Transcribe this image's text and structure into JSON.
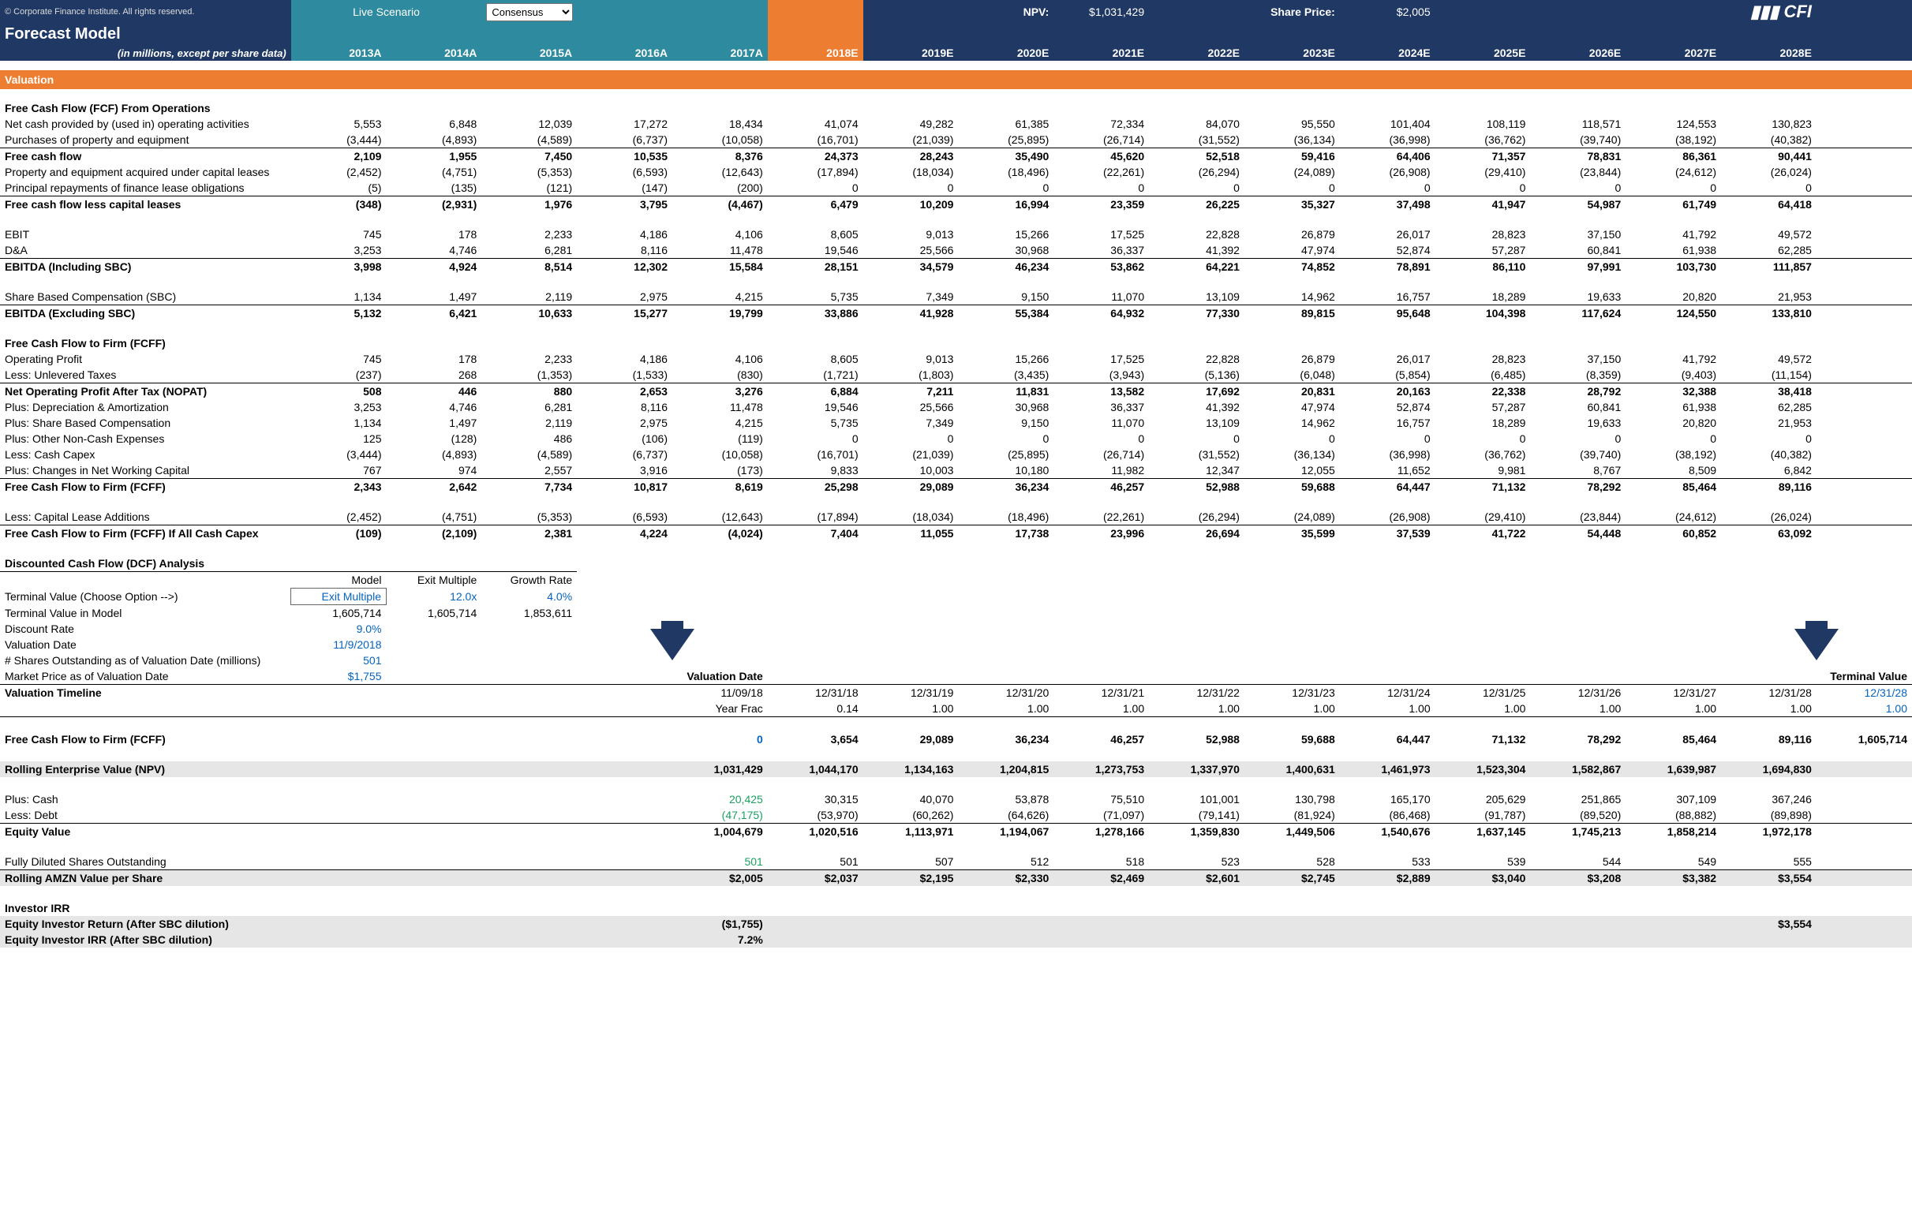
{
  "header": {
    "copyright": "© Corporate Finance Institute. All rights reserved.",
    "title": "Forecast Model",
    "subtitle": "(in millions, except per share data)",
    "live_scenario_label": "Live Scenario",
    "scenario_value": "Consensus",
    "npv_label": "NPV:",
    "npv_value": "$1,031,429",
    "share_price_label": "Share Price:",
    "share_price_value": "$2,005",
    "logo": "CFI",
    "years": [
      "2013A",
      "2014A",
      "2015A",
      "2016A",
      "2017A",
      "2018E",
      "2019E",
      "2020E",
      "2021E",
      "2022E",
      "2023E",
      "2024E",
      "2025E",
      "2026E",
      "2027E",
      "2028E"
    ]
  },
  "section_valuation": "Valuation",
  "rows": {
    "fcf_ops_title": "Free Cash Flow (FCF) From Operations",
    "net_cash": {
      "l": "Net cash provided by (used in) operating activities",
      "v": [
        "5,553",
        "6,848",
        "12,039",
        "17,272",
        "18,434",
        "41,074",
        "49,282",
        "61,385",
        "72,334",
        "84,070",
        "95,550",
        "101,404",
        "108,119",
        "118,571",
        "124,553",
        "130,823"
      ]
    },
    "purchases": {
      "l": "Purchases of property and equipment",
      "v": [
        "(3,444)",
        "(4,893)",
        "(4,589)",
        "(6,737)",
        "(10,058)",
        "(16,701)",
        "(21,039)",
        "(25,895)",
        "(26,714)",
        "(31,552)",
        "(36,134)",
        "(36,998)",
        "(36,762)",
        "(39,740)",
        "(38,192)",
        "(40,382)"
      ]
    },
    "fcf": {
      "l": "Free cash flow",
      "v": [
        "2,109",
        "1,955",
        "7,450",
        "10,535",
        "8,376",
        "24,373",
        "28,243",
        "35,490",
        "45,620",
        "52,518",
        "59,416",
        "64,406",
        "71,357",
        "78,831",
        "86,361",
        "90,441"
      ]
    },
    "cap_lease": {
      "l": "Property and equipment acquired under capital leases",
      "v": [
        "(2,452)",
        "(4,751)",
        "(5,353)",
        "(6,593)",
        "(12,643)",
        "(17,894)",
        "(18,034)",
        "(18,496)",
        "(22,261)",
        "(26,294)",
        "(24,089)",
        "(26,908)",
        "(29,410)",
        "(23,844)",
        "(24,612)",
        "(26,024)"
      ]
    },
    "fin_lease": {
      "l": "Principal repayments of finance lease obligations",
      "v": [
        "(5)",
        "(135)",
        "(121)",
        "(147)",
        "(200)",
        "0",
        "0",
        "0",
        "0",
        "0",
        "0",
        "0",
        "0",
        "0",
        "0",
        "0"
      ]
    },
    "fcf_less": {
      "l": "Free cash flow less capital leases",
      "v": [
        "(348)",
        "(2,931)",
        "1,976",
        "3,795",
        "(4,467)",
        "6,479",
        "10,209",
        "16,994",
        "23,359",
        "26,225",
        "35,327",
        "37,498",
        "41,947",
        "54,987",
        "61,749",
        "64,418"
      ]
    },
    "ebit": {
      "l": "EBIT",
      "v": [
        "745",
        "178",
        "2,233",
        "4,186",
        "4,106",
        "8,605",
        "9,013",
        "15,266",
        "17,525",
        "22,828",
        "26,879",
        "26,017",
        "28,823",
        "37,150",
        "41,792",
        "49,572"
      ]
    },
    "da": {
      "l": "D&A",
      "v": [
        "3,253",
        "4,746",
        "6,281",
        "8,116",
        "11,478",
        "19,546",
        "25,566",
        "30,968",
        "36,337",
        "41,392",
        "47,974",
        "52,874",
        "57,287",
        "60,841",
        "61,938",
        "62,285"
      ]
    },
    "ebitda_inc": {
      "l": "EBITDA (Including SBC)",
      "v": [
        "3,998",
        "4,924",
        "8,514",
        "12,302",
        "15,584",
        "28,151",
        "34,579",
        "46,234",
        "53,862",
        "64,221",
        "74,852",
        "78,891",
        "86,110",
        "97,991",
        "103,730",
        "111,857"
      ]
    },
    "sbc": {
      "l": "Share Based Compensation (SBC)",
      "v": [
        "1,134",
        "1,497",
        "2,119",
        "2,975",
        "4,215",
        "5,735",
        "7,349",
        "9,150",
        "11,070",
        "13,109",
        "14,962",
        "16,757",
        "18,289",
        "19,633",
        "20,820",
        "21,953"
      ]
    },
    "ebitda_ex": {
      "l": "EBITDA (Excluding SBC)",
      "v": [
        "5,132",
        "6,421",
        "10,633",
        "15,277",
        "19,799",
        "33,886",
        "41,928",
        "55,384",
        "64,932",
        "77,330",
        "89,815",
        "95,648",
        "104,398",
        "117,624",
        "124,550",
        "133,810"
      ]
    },
    "fcff_title": "Free Cash Flow to Firm (FCFF)",
    "op_profit": {
      "l": "Operating Profit",
      "v": [
        "745",
        "178",
        "2,233",
        "4,186",
        "4,106",
        "8,605",
        "9,013",
        "15,266",
        "17,525",
        "22,828",
        "26,879",
        "26,017",
        "28,823",
        "37,150",
        "41,792",
        "49,572"
      ]
    },
    "unlev_tax": {
      "l": "  Less: Unlevered Taxes",
      "v": [
        "(237)",
        "268",
        "(1,353)",
        "(1,533)",
        "(830)",
        "(1,721)",
        "(1,803)",
        "(3,435)",
        "(3,943)",
        "(5,136)",
        "(6,048)",
        "(5,854)",
        "(6,485)",
        "(8,359)",
        "(9,403)",
        "(11,154)"
      ]
    },
    "nopat": {
      "l": "Net Operating Profit After Tax (NOPAT)",
      "v": [
        "508",
        "446",
        "880",
        "2,653",
        "3,276",
        "6,884",
        "7,211",
        "11,831",
        "13,582",
        "17,692",
        "20,831",
        "20,163",
        "22,338",
        "28,792",
        "32,388",
        "38,418"
      ]
    },
    "plus_da": {
      "l": "  Plus: Depreciation & Amortization",
      "v": [
        "3,253",
        "4,746",
        "6,281",
        "8,116",
        "11,478",
        "19,546",
        "25,566",
        "30,968",
        "36,337",
        "41,392",
        "47,974",
        "52,874",
        "57,287",
        "60,841",
        "61,938",
        "62,285"
      ]
    },
    "plus_sbc": {
      "l": "  Plus: Share Based Compensation",
      "v": [
        "1,134",
        "1,497",
        "2,119",
        "2,975",
        "4,215",
        "5,735",
        "7,349",
        "9,150",
        "11,070",
        "13,109",
        "14,962",
        "16,757",
        "18,289",
        "19,633",
        "20,820",
        "21,953"
      ]
    },
    "plus_other": {
      "l": "  Plus: Other Non-Cash Expenses",
      "v": [
        "125",
        "(128)",
        "486",
        "(106)",
        "(119)",
        "0",
        "0",
        "0",
        "0",
        "0",
        "0",
        "0",
        "0",
        "0",
        "0",
        "0"
      ]
    },
    "less_capex": {
      "l": "  Less: Cash Capex",
      "v": [
        "(3,444)",
        "(4,893)",
        "(4,589)",
        "(6,737)",
        "(10,058)",
        "(16,701)",
        "(21,039)",
        "(25,895)",
        "(26,714)",
        "(31,552)",
        "(36,134)",
        "(36,998)",
        "(36,762)",
        "(39,740)",
        "(38,192)",
        "(40,382)"
      ]
    },
    "plus_nwc": {
      "l": "  Plus: Changes in Net Working Capital",
      "v": [
        "767",
        "974",
        "2,557",
        "3,916",
        "(173)",
        "9,833",
        "10,003",
        "10,180",
        "11,982",
        "12,347",
        "12,055",
        "11,652",
        "9,981",
        "8,767",
        "8,509",
        "6,842"
      ]
    },
    "fcff": {
      "l": "Free Cash Flow to Firm (FCFF)",
      "v": [
        "2,343",
        "2,642",
        "7,734",
        "10,817",
        "8,619",
        "25,298",
        "29,089",
        "36,234",
        "46,257",
        "52,988",
        "59,688",
        "64,447",
        "71,132",
        "78,292",
        "85,464",
        "89,116"
      ]
    },
    "less_cla": {
      "l": "  Less: Capital Lease Additions",
      "v": [
        "(2,452)",
        "(4,751)",
        "(5,353)",
        "(6,593)",
        "(12,643)",
        "(17,894)",
        "(18,034)",
        "(18,496)",
        "(22,261)",
        "(26,294)",
        "(24,089)",
        "(26,908)",
        "(29,410)",
        "(23,844)",
        "(24,612)",
        "(26,024)"
      ]
    },
    "fcff_all": {
      "l": "Free Cash Flow to Firm (FCFF) If All Cash Capex",
      "v": [
        "(109)",
        "(2,109)",
        "2,381",
        "4,224",
        "(4,024)",
        "7,404",
        "11,055",
        "17,738",
        "23,996",
        "26,694",
        "35,599",
        "37,539",
        "41,722",
        "54,448",
        "60,852",
        "63,092"
      ]
    }
  },
  "dcf": {
    "title": "Discounted Cash Flow (DCF) Analysis",
    "cols": [
      "Model",
      "Exit Multiple",
      "Growth Rate"
    ],
    "tv_choose": {
      "l": "Terminal Value (Choose Option -->)",
      "v": [
        "Exit Multiple",
        "12.0x",
        "4.0%"
      ]
    },
    "tv_model": {
      "l": "Terminal Value in Model",
      "v": [
        "1,605,714",
        "1,605,714",
        "1,853,611"
      ]
    },
    "disc_rate": {
      "l": "Discount Rate",
      "v": "9.0%"
    },
    "val_date": {
      "l": "Valuation Date",
      "v": "11/9/2018"
    },
    "shares_out": {
      "l": "# Shares Outstanding as of Valuation Date (millions)",
      "v": "501"
    },
    "mkt_price": {
      "l": "Market Price as of Valuation Date",
      "v": "$1,755"
    }
  },
  "timeline": {
    "val_date_label": "Valuation Date",
    "term_val_label": "Terminal Value",
    "title": "Valuation Timeline",
    "dates": [
      "11/09/18",
      "12/31/18",
      "12/31/19",
      "12/31/20",
      "12/31/21",
      "12/31/22",
      "12/31/23",
      "12/31/24",
      "12/31/25",
      "12/31/26",
      "12/31/27",
      "12/31/28",
      "12/31/28"
    ],
    "yf_label": "Year Frac",
    "year_frac": [
      "0.14",
      "1.00",
      "1.00",
      "1.00",
      "1.00",
      "1.00",
      "1.00",
      "1.00",
      "1.00",
      "1.00",
      "1.00",
      "1.00",
      "1.00"
    ],
    "fcff_label": "Free Cash Flow to Firm (FCFF)",
    "fcff": [
      "0",
      "3,654",
      "29,089",
      "36,234",
      "46,257",
      "52,988",
      "59,688",
      "64,447",
      "71,132",
      "78,292",
      "85,464",
      "89,116",
      "1,605,714"
    ],
    "npv_label": "Rolling Enterprise Value (NPV)",
    "npv": [
      "1,031,429",
      "1,044,170",
      "1,134,163",
      "1,204,815",
      "1,273,753",
      "1,337,970",
      "1,400,631",
      "1,461,973",
      "1,523,304",
      "1,582,867",
      "1,639,987",
      "1,694,830"
    ],
    "plus_cash": {
      "l": "Plus: Cash",
      "v": [
        "20,425",
        "30,315",
        "40,070",
        "53,878",
        "75,510",
        "101,001",
        "130,798",
        "165,170",
        "205,629",
        "251,865",
        "307,109",
        "367,246"
      ]
    },
    "less_debt": {
      "l": "Less: Debt",
      "v": [
        "(47,175)",
        "(53,970)",
        "(60,262)",
        "(64,626)",
        "(71,097)",
        "(79,141)",
        "(81,924)",
        "(86,468)",
        "(91,787)",
        "(89,520)",
        "(88,882)",
        "(89,898)"
      ]
    },
    "equity": {
      "l": "Equity Value",
      "v": [
        "1,004,679",
        "1,020,516",
        "1,113,971",
        "1,194,067",
        "1,278,166",
        "1,359,830",
        "1,449,506",
        "1,540,676",
        "1,637,145",
        "1,745,213",
        "1,858,214",
        "1,972,178"
      ]
    },
    "fd_shares": {
      "l": "Fully Diluted Shares Outstanding",
      "v": [
        "501",
        "501",
        "507",
        "512",
        "518",
        "523",
        "528",
        "533",
        "539",
        "544",
        "549",
        "555"
      ]
    },
    "rolling": {
      "l": "Rolling AMZN Value per Share",
      "v": [
        "$2,005",
        "$2,037",
        "$2,195",
        "$2,330",
        "$2,469",
        "$2,601",
        "$2,745",
        "$2,889",
        "$3,040",
        "$3,208",
        "$3,382",
        "$3,554"
      ]
    }
  },
  "irr": {
    "title": "Investor IRR",
    "ret_label": "Equity Investor Return (After SBC dilution)",
    "ret_first": "($1,755)",
    "ret_last": "$3,554",
    "irr_label": "Equity Investor IRR (After SBC dilution)",
    "irr_val": "7.2%"
  }
}
